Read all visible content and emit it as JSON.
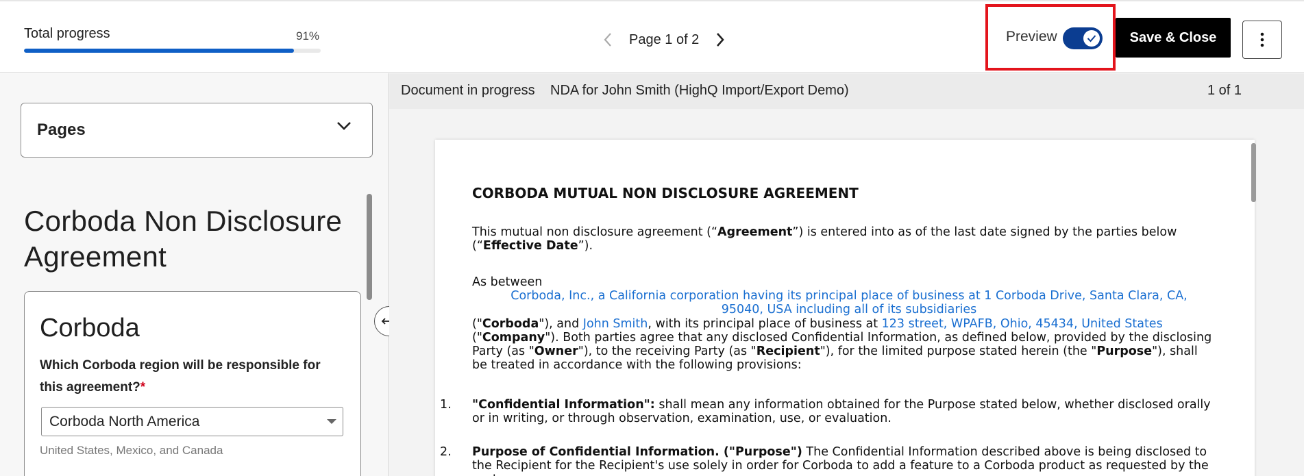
{
  "header": {
    "progress_label": "Total progress",
    "progress_pct_text": "91%",
    "progress_value": 91,
    "page_indicator": "Page 1 of 2",
    "preview_label": "Preview",
    "preview_on": true,
    "save_label": "Save & Close",
    "accent_color": "#0f5fc6",
    "highlight_color": "#e3141c"
  },
  "left": {
    "pages_label": "Pages",
    "form_title": "Corboda Non Disclosure Agreement",
    "card": {
      "title": "Corboda",
      "question": "Which Corboda region will be responsible for this agreement?",
      "required_mark": "*",
      "select_value": "Corboda North America",
      "hint": "United States, Mexico, and Canada"
    }
  },
  "doc_bar": {
    "status": "Document in progress",
    "name": "NDA for John Smith (HighQ Import/Export Demo)",
    "count": "1 of 1"
  },
  "document": {
    "heading": "CORBODA MUTUAL NON DISCLOSURE AGREEMENT",
    "intro_1": "This mutual non disclosure agreement (“",
    "intro_agreement": "Agreement",
    "intro_2": "”) is entered into as of the last date signed by the parties below (“",
    "intro_effective": "Effective Date",
    "intro_3": "”).",
    "as_between": "As between",
    "corboda_entity": "Corboda, Inc., a California corporation having its principal place of business at 1 Corboda Drive, Santa Clara, CA, 95040, USA including all of its subsidiaries",
    "pb_1": "(\"",
    "pb_corboda": "Corboda",
    "pb_2": "\"), and ",
    "pb_name": "John Smith",
    "pb_3": ", with its principal place of business at ",
    "pb_address": "123 street, WPAFB, Ohio, 45434, United States",
    "pb_4": " (\"",
    "pb_company": "Company",
    "pb_5": "\").  Both parties agree that any disclosed Confidential Information, as defined below, provided by the disclosing Party (as \"",
    "pb_owner": "Owner",
    "pb_6": "\"), to the receiving Party (as \"",
    "pb_recipient": "Recipient",
    "pb_7": "\"), for the limited purpose stated herein (the \"",
    "pb_purpose": "Purpose",
    "pb_8": "\"), shall be treated in accordance with the following provisions:",
    "item1_num": "1.",
    "item1_bold": "\"Confidential Information\":",
    "item1_text": " shall mean any information obtained for the Purpose stated below, whether disclosed orally or in writing, or through observation, examination, use, or evaluation.",
    "item2_num": "2.",
    "item2_bold": "Purpose of Confidential Information. (\"Purpose\")",
    "item2_text": " The Confidential Information described above is being disclosed to the Recipient for the Recipient's use solely in order for Corboda to add a feature to a Corboda product as requested by the customer."
  }
}
